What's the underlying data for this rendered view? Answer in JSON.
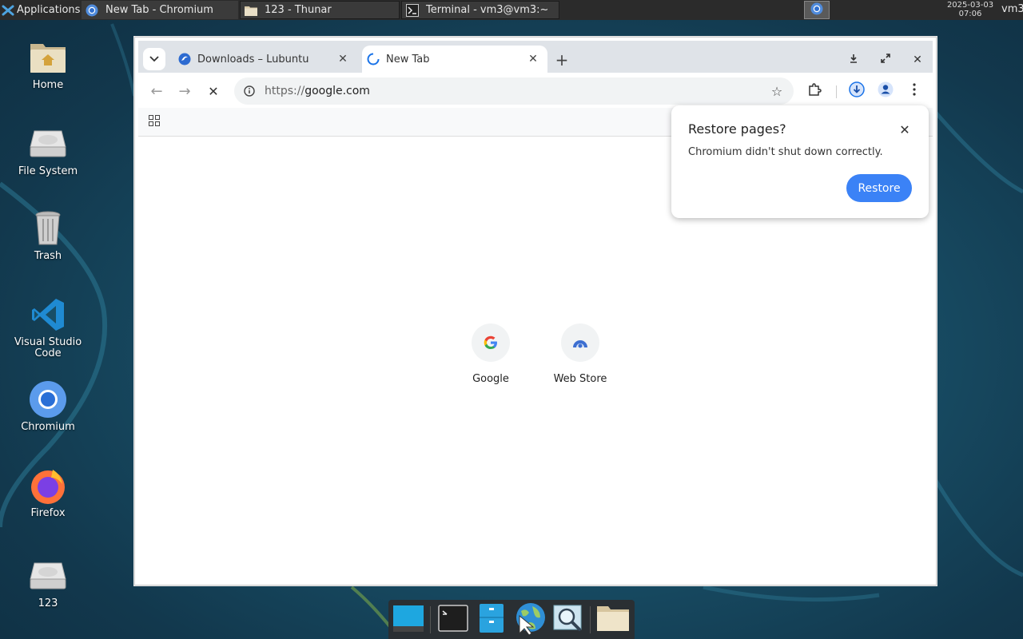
{
  "top_panel": {
    "applications_label": "Applications",
    "tasks": [
      {
        "label": "New Tab - Chromium",
        "icon": "chromium-icon"
      },
      {
        "label": "123 - Thunar",
        "icon": "folder-icon"
      },
      {
        "label": "Terminal - vm3@vm3:~",
        "icon": "terminal-icon"
      }
    ],
    "clock_date": "2025-03-03",
    "clock_time": "07:06",
    "user": "vm3"
  },
  "desktop_icons": [
    {
      "label": "Home",
      "icon": "home-folder-icon"
    },
    {
      "label": "File System",
      "icon": "drive-icon"
    },
    {
      "label": "Trash",
      "icon": "trash-icon"
    },
    {
      "label": "Visual Studio Code",
      "icon": "vscode-icon"
    },
    {
      "label": "Chromium",
      "icon": "chromium-icon"
    },
    {
      "label": "Firefox",
      "icon": "firefox-icon"
    },
    {
      "label": "123",
      "icon": "drive-icon"
    }
  ],
  "browser": {
    "tabs": [
      {
        "label": "Downloads – Lubuntu",
        "active": false
      },
      {
        "label": "New Tab",
        "active": true
      }
    ],
    "url_scheme": "https://",
    "url_host": "google.com",
    "shortcuts": [
      {
        "label": "Google",
        "icon": "google-g-icon"
      },
      {
        "label": "Web Store",
        "icon": "web-store-icon"
      }
    ]
  },
  "restore_popup": {
    "title": "Restore pages?",
    "message": "Chromium didn't shut down correctly.",
    "button": "Restore"
  },
  "dock": {
    "items": [
      "show-desktop-icon",
      "terminal-icon",
      "file-manager-icon",
      "web-browser-icon",
      "app-finder-icon",
      "folder-icon"
    ]
  },
  "colors": {
    "accent": "#3b82f6",
    "panel": "#2b2b2b",
    "desktop": "#184e66"
  }
}
